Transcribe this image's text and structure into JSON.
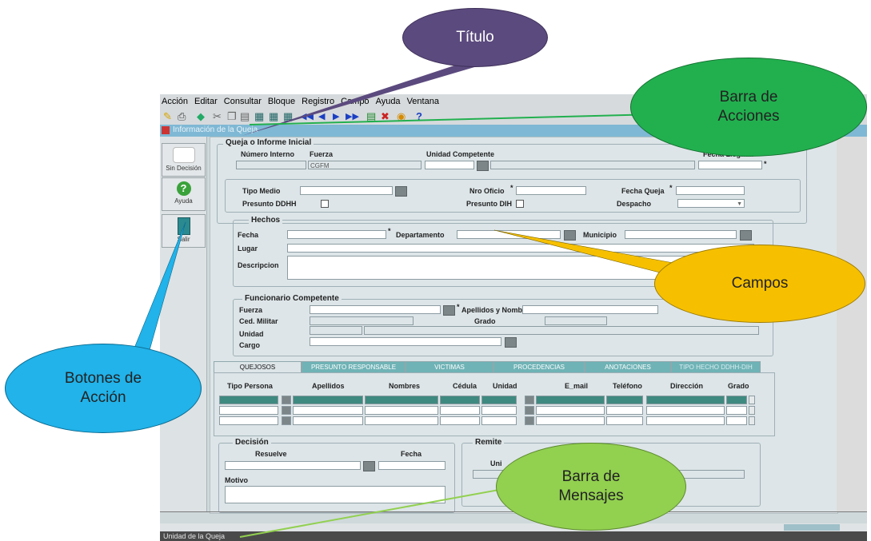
{
  "menubar": {
    "items": [
      "Acción",
      "Editar",
      "Consultar",
      "Bloque",
      "Registro",
      "Campo",
      "Ayuda",
      "Ventana"
    ]
  },
  "toolbar": {
    "help_glyph": "?"
  },
  "window": {
    "title": "Información de la Queja"
  },
  "action_buttons": [
    {
      "label": "Sin Decisión",
      "icon": "speech-bubble-icon"
    },
    {
      "label": "Ayuda",
      "icon": "help-icon"
    },
    {
      "label": "Salir",
      "icon": "exit-door-icon"
    }
  ],
  "queja": {
    "title": "Queja o Informe Inicial",
    "numero_interno_label": "Número Interno",
    "fuerza_label": "Fuerza",
    "fuerza_value": "CGFM",
    "unidad_competente_label": "Unidad Competente",
    "fecha_llegada_label": "Fecha Llegada",
    "required_mark": "*",
    "tipo_medio_label": "Tipo Medio",
    "nro_oficio_label": "Nro Oficio",
    "fecha_queja_label": "Fecha Queja",
    "presunto_ddhh_label": "Presunto DDHH",
    "presunto_dih_label": "Presunto DIH",
    "despacho_label": "Despacho"
  },
  "hechos": {
    "title": "Hechos",
    "fecha_label": "Fecha",
    "departamento_label": "Departamento",
    "municipio_label": "Municipio",
    "lugar_label": "Lugar",
    "descripcion_label": "Descripcion"
  },
  "funcionario": {
    "title": "Funcionario Competente",
    "fuerza_label": "Fuerza",
    "apellidos_label": "Apellidos y Nombres",
    "ced_militar_label": "Ced. Militar",
    "grado_label": "Grado",
    "unidad_label": "Unidad",
    "cargo_label": "Cargo"
  },
  "tabs": [
    "QUEJOSOS",
    "PRESUNTO RESPONSABLE",
    "VICTIMAS",
    "PROCEDENCIAS",
    "ANOTACIONES",
    "TIPO HECHO DDHH-DIH"
  ],
  "grid": {
    "headers": [
      "Tipo Persona",
      "Apellidos",
      "Nombres",
      "Cédula",
      "Unidad",
      "E_mail",
      "Teléfono",
      "Dirección",
      "Grado"
    ]
  },
  "decision": {
    "title": "Decisión",
    "resuelve_label": "Resuelve",
    "fecha_label": "Fecha",
    "motivo_label": "Motivo"
  },
  "remite": {
    "title": "Remite",
    "unidad_label": "Uni"
  },
  "status": {
    "text": "Unidad de la Queja"
  },
  "callouts": {
    "titulo": "Título",
    "barra_acciones": "Barra de Acciones",
    "campos": "Campos",
    "botones_accion": "Botones de Acción",
    "barra_mensajes": "Barra de Mensajes"
  },
  "colors": {
    "titulo": "#5b4a7e",
    "barra_acciones": "#22b04f",
    "campos": "#f6c000",
    "botones_accion": "#21b3ea",
    "barra_mensajes": "#92d050"
  }
}
